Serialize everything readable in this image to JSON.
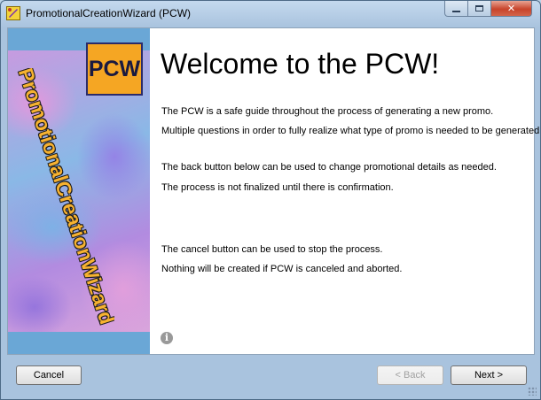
{
  "window": {
    "title": "PromotionalCreationWizard (PCW)"
  },
  "banner": {
    "logo_text": "PCW",
    "vertical_text": "PromotionalCreationWizard"
  },
  "content": {
    "heading": "Welcome to the PCW!",
    "paragraphs": [
      "The PCW is a safe guide throughout the process of generating a new promo.",
      "Multiple questions in order to fully realize what type of promo is needed to be generated.",
      "The back button below can be used to change promotional details as needed.",
      "The process is not finalized until there is confirmation.",
      "The cancel button can be used to stop the process.",
      "Nothing will be created if PCW is canceled and aborted."
    ]
  },
  "buttons": {
    "cancel": "Cancel",
    "back": "< Back",
    "next": "Next >",
    "back_enabled": false
  },
  "colors": {
    "banner_bg": "#6aa7d6",
    "logo_bg": "#f5a623",
    "vertical_text": "#f7b230"
  },
  "icons": [
    "app-icon",
    "minimize-icon",
    "maximize-icon",
    "close-icon",
    "info-icon",
    "resize-grip-icon"
  ]
}
